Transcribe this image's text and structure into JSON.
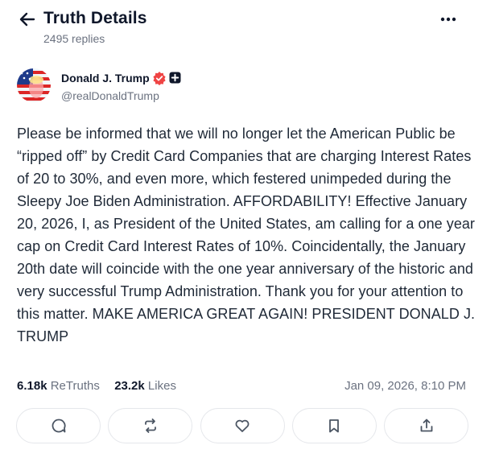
{
  "header": {
    "title": "Truth Details",
    "replies": "2495 replies",
    "back_icon": "arrow-left-icon",
    "more_icon": "more-horizontal-icon"
  },
  "author": {
    "name": "Donald J. Trump",
    "handle": "@realDonaldTrump",
    "verified_icon": "verified-badge-icon",
    "plus_icon": "plus-badge-icon",
    "verified_color": "#ef4444"
  },
  "post": {
    "text": "Please be informed that we will no longer let the American Public be “ripped off” by Credit Card Companies that are charging Interest Rates of 20 to 30%, and even more, which festered unimpeded during the Sleepy Joe Biden Administration. AFFORDABILITY! Effective January 20, 2026, I, as President of the United States, am calling for a one year cap on Credit Card Interest Rates of 10%. Coincidentally, the January 20th date will coincide with the one year anniversary of the historic and very successful Trump Administration. Thank you for your attention to this matter. MAKE AMERICA GREAT AGAIN! PRESIDENT DONALD J. TRUMP",
    "retruths_count": "6.18k",
    "retruths_label": "ReTruths",
    "likes_count": "23.2k",
    "likes_label": "Likes",
    "timestamp": "Jan 09, 2026, 8:10 PM"
  },
  "actions": [
    {
      "name": "reply",
      "icon": "comment-icon"
    },
    {
      "name": "retruth",
      "icon": "repost-icon"
    },
    {
      "name": "like",
      "icon": "heart-icon"
    },
    {
      "name": "bookmark",
      "icon": "bookmark-icon"
    },
    {
      "name": "share",
      "icon": "share-icon"
    }
  ]
}
